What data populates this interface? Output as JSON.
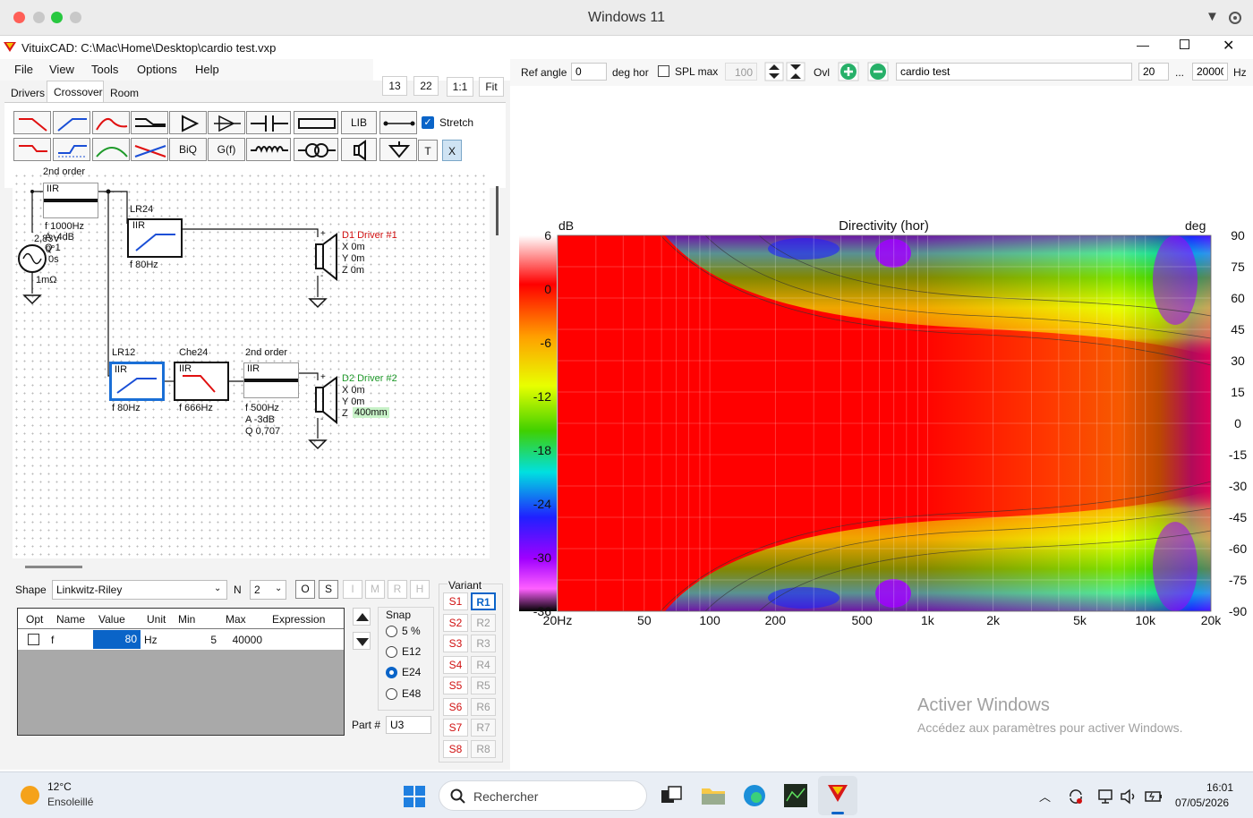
{
  "mac": {
    "title": "Windows 11"
  },
  "app": {
    "title": "VituixCAD: C:\\Mac\\Home\\Desktop\\cardio test.vxp"
  },
  "menu": [
    "File",
    "View",
    "Tools",
    "Options",
    "Help"
  ],
  "zoom_buttons": [
    "13",
    "22",
    "1:1",
    "Fit"
  ],
  "tabs": [
    "Drivers",
    "Crossover",
    "Room"
  ],
  "toolbar": {
    "lib": "LIB",
    "stretch": "Stretch",
    "stretch_checked": true,
    "biq": "BiQ",
    "gf": "G(f)",
    "t": "T",
    "x": "X"
  },
  "schematic": {
    "source": {
      "lines": [
        "2,83V",
        "0°",
        "0s",
        "1mΩ"
      ]
    },
    "block1": {
      "title": "2nd order",
      "type": "IIR",
      "params": [
        "f  1000Hz",
        "A  -4dB",
        "Q  1"
      ]
    },
    "block2": {
      "title": "LR24",
      "type": "IIR",
      "params": [
        "f  80Hz"
      ]
    },
    "driver1": {
      "name": "D1 Driver #1",
      "params": [
        "X 0m",
        "Y 0m",
        "Z 0m"
      ]
    },
    "block3": {
      "title": "LR12",
      "type": "IIR",
      "params": [
        "f  80Hz"
      ]
    },
    "block4": {
      "title": "Che24",
      "type": "IIR",
      "params": [
        "f  666Hz"
      ]
    },
    "block5": {
      "title": "2nd order",
      "type": "IIR",
      "params": [
        "f  500Hz",
        "A  -3dB",
        "Q 0,707"
      ]
    },
    "driver2": {
      "name": "D2 Driver #2",
      "params": [
        "X 0m",
        "Y 0m"
      ],
      "z_label": "Z",
      "z_value": "400mm"
    }
  },
  "bottom": {
    "shape_label": "Shape",
    "shape_value": "Linkwitz-Riley",
    "n_label": "N",
    "n_value": "2",
    "mode_buttons": [
      "O",
      "S",
      "I",
      "M",
      "R",
      "H"
    ],
    "table": {
      "headers": [
        "Opt",
        "Name",
        "Value",
        "Unit",
        "Min",
        "Max",
        "Expression"
      ],
      "rows": [
        {
          "name": "f",
          "value": "80",
          "unit": "Hz",
          "min": "5",
          "max": "40000",
          "expression": ""
        }
      ]
    },
    "snap": {
      "label": "Snap",
      "options": [
        "5 %",
        "E12",
        "E24",
        "E48"
      ],
      "selected": "E24"
    },
    "part_label": "Part #",
    "part_value": "U3",
    "variant": {
      "label": "Variant",
      "s": [
        "S1",
        "S2",
        "S3",
        "S4",
        "S5",
        "S6",
        "S7",
        "S8"
      ],
      "r": [
        "R1",
        "R2",
        "R3",
        "R4",
        "R5",
        "R6",
        "R7",
        "R8"
      ],
      "active_r": "R1"
    }
  },
  "chart_controls": {
    "ref_angle_label": "Ref angle",
    "ref_angle": "0",
    "deg_hor": "deg hor",
    "spl_max_label": "SPL max",
    "spl_max": "100",
    "ovl": "Ovl",
    "name": "cardio test",
    "f_min": "20",
    "dots": "...",
    "f_max": "20000",
    "unit": "Hz"
  },
  "chart_data": {
    "type": "heatmap",
    "title": "Directivity (hor)",
    "colorbar_unit": "dB",
    "colorbar_ticks": [
      "6",
      "0",
      "-6",
      "-12",
      "-18",
      "-24",
      "-30",
      "-36"
    ],
    "right_unit": "deg",
    "y_ticks": [
      "90",
      "75",
      "60",
      "45",
      "30",
      "15",
      "0",
      "-15",
      "-30",
      "-45",
      "-60",
      "-75",
      "-90"
    ],
    "x_ticks": [
      "20Hz",
      "50",
      "100",
      "200",
      "500",
      "1k",
      "2k",
      "5k",
      "10k",
      "20k"
    ],
    "x_range": [
      20,
      20000
    ],
    "x_scale": "log",
    "y_range": [
      -90,
      90
    ],
    "z_range": [
      -36,
      6
    ],
    "grid": true
  },
  "watermark": {
    "title": "Activer Windows",
    "sub": "Accédez aux paramètres pour activer Windows."
  },
  "taskbar": {
    "temp": "12°C",
    "weather": "Ensoleillé",
    "search": "Rechercher",
    "time": "16:01",
    "date": "07/05/2026"
  },
  "colors": {
    "accent": "#0a64c8",
    "drivers": "#d01010"
  }
}
